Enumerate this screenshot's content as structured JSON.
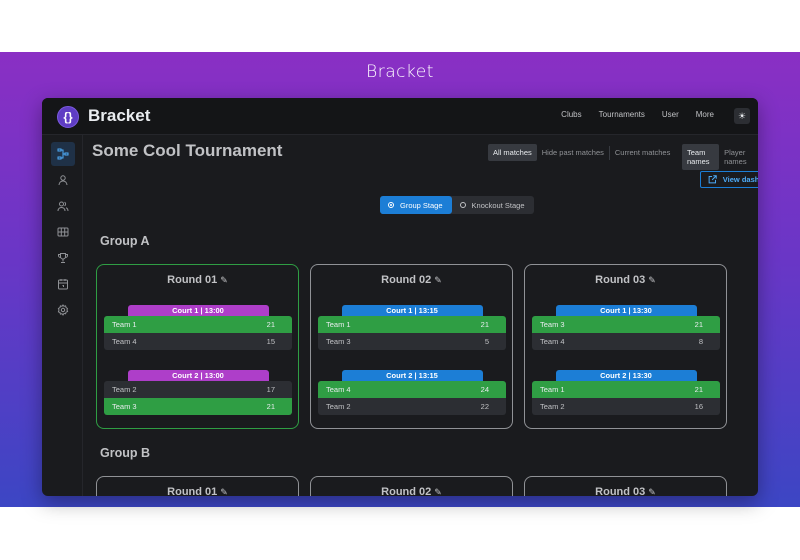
{
  "banner": {
    "title": "Bracket"
  },
  "app": {
    "name": "Bracket",
    "logo_text": "{}"
  },
  "nav": {
    "items": [
      "Clubs",
      "Tournaments",
      "User",
      "More"
    ]
  },
  "theme_toggle": {
    "icon": "sun-icon"
  },
  "sidebar": {
    "items": [
      {
        "icon": "bracket-icon",
        "active": true
      },
      {
        "icon": "user-icon"
      },
      {
        "icon": "users-icon"
      },
      {
        "icon": "table-icon"
      },
      {
        "icon": "trophy-icon"
      },
      {
        "icon": "calendar-icon"
      },
      {
        "icon": "settings-icon"
      }
    ]
  },
  "page": {
    "title": "Some Cool Tournament"
  },
  "match_filter": {
    "options": [
      "All matches",
      "Hide past matches",
      "Current matches"
    ],
    "selected": "All matches"
  },
  "name_filter": {
    "options": [
      "Team names",
      "Player names"
    ],
    "selected": "Team names"
  },
  "view_dashboard": {
    "label": "View dashboard"
  },
  "stages": {
    "options": [
      "Group Stage",
      "Knockout Stage"
    ],
    "selected": "Group Stage"
  },
  "colors": {
    "court_purple": "#ae3ec9",
    "court_blue": "#1c7ed6",
    "win_green": "#2f9e44",
    "accent": "#1c7ed6"
  },
  "groups": [
    {
      "title": "Group A",
      "rounds": [
        {
          "title": "Round 01",
          "active": true,
          "matches": [
            {
              "court": "Court 1 | 13:00",
              "color": "purple",
              "teams": [
                {
                  "name": "Team 1",
                  "score": "21",
                  "win": true
                },
                {
                  "name": "Team 4",
                  "score": "15",
                  "win": false
                }
              ]
            },
            {
              "court": "Court 2 | 13:00",
              "color": "purple",
              "teams": [
                {
                  "name": "Team 2",
                  "score": "17",
                  "win": false
                },
                {
                  "name": "Team 3",
                  "score": "21",
                  "win": true
                }
              ]
            }
          ]
        },
        {
          "title": "Round 02",
          "active": false,
          "matches": [
            {
              "court": "Court 1 | 13:15",
              "color": "blue",
              "teams": [
                {
                  "name": "Team 1",
                  "score": "21",
                  "win": true
                },
                {
                  "name": "Team 3",
                  "score": "5",
                  "win": false
                }
              ]
            },
            {
              "court": "Court 2 | 13:15",
              "color": "blue",
              "teams": [
                {
                  "name": "Team 4",
                  "score": "24",
                  "win": true
                },
                {
                  "name": "Team 2",
                  "score": "22",
                  "win": false
                }
              ]
            }
          ]
        },
        {
          "title": "Round 03",
          "active": false,
          "matches": [
            {
              "court": "Court 1 | 13:30",
              "color": "blue",
              "teams": [
                {
                  "name": "Team 3",
                  "score": "21",
                  "win": true
                },
                {
                  "name": "Team 4",
                  "score": "8",
                  "win": false
                }
              ]
            },
            {
              "court": "Court 2 | 13:30",
              "color": "blue",
              "teams": [
                {
                  "name": "Team 1",
                  "score": "21",
                  "win": true
                },
                {
                  "name": "Team 2",
                  "score": "16",
                  "win": false
                }
              ]
            }
          ]
        }
      ]
    },
    {
      "title": "Group B",
      "rounds": [
        {
          "title": "Round 01"
        },
        {
          "title": "Round 02"
        },
        {
          "title": "Round 03"
        }
      ]
    }
  ]
}
